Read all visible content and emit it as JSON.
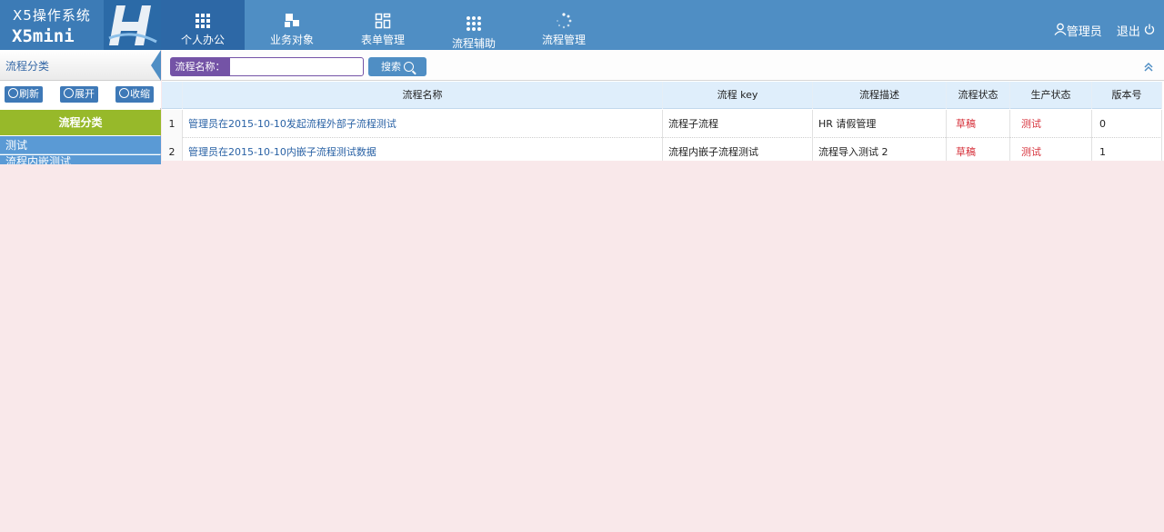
{
  "brand": {
    "title": "X5操作系统",
    "subtitle": "X5mini",
    "accent": "#4f8ec4"
  },
  "nav": [
    {
      "label": "个人办公",
      "icon": "grid-icon",
      "active": true
    },
    {
      "label": "业务对象",
      "icon": "blocks-icon",
      "active": false
    },
    {
      "label": "表单管理",
      "icon": "form-icon",
      "active": false
    },
    {
      "label": "流程辅助",
      "icon": "dots-icon",
      "active": false
    },
    {
      "label": "流程管理",
      "icon": "loading-icon",
      "active": false
    }
  ],
  "user": {
    "admin_label": "管理员",
    "logout_label": "退出"
  },
  "sidebar": {
    "title": "流程分类",
    "tools": {
      "refresh": "刷新",
      "expand": "展开",
      "collapse": "收缩"
    },
    "category": "流程分类",
    "items": [
      "测试",
      "流程内嵌测试"
    ]
  },
  "search": {
    "label": "流程名称：",
    "value": "",
    "button": "搜索"
  },
  "table": {
    "headers": [
      "",
      "流程名称",
      "流程 key",
      "流程描述",
      "流程状态",
      "生产状态",
      "版本号"
    ],
    "rows": [
      {
        "no": "1",
        "name": "管理员在2015-10-10发起流程外部子流程测试",
        "key": "流程子流程",
        "desc": "HR 请假管理",
        "status": "草稿",
        "prod": "测试",
        "version": "0"
      },
      {
        "no": "2",
        "name": "管理员在2015-10-10内嵌子流程测试数据",
        "key": "流程内嵌子流程测试",
        "desc": "流程导入测试 2",
        "status": "草稿",
        "prod": "测试",
        "version": "1"
      }
    ]
  }
}
